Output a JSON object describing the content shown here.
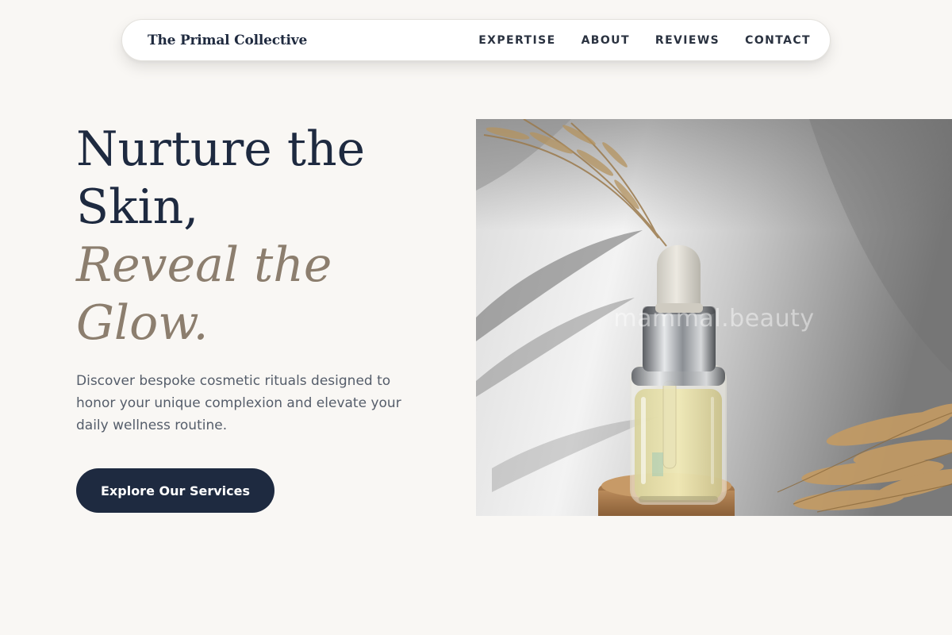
{
  "nav": {
    "brand": "The Primal Collective",
    "links": [
      {
        "label": "EXPERTISE"
      },
      {
        "label": "ABOUT"
      },
      {
        "label": "REVIEWS"
      },
      {
        "label": "CONTACT"
      }
    ]
  },
  "hero": {
    "headline_line1": "Nurture the Skin,",
    "headline_line2": "Reveal the Glow.",
    "description": "Discover bespoke cosmetic rituals designed to honor your unique complexion and elevate your daily wellness routine.",
    "cta_label": "Explore Our Services",
    "image_watermark": "mammal.beauty"
  },
  "colors": {
    "background": "#f9f7f4",
    "navy": "#1e2a40",
    "accent_taupe": "#8c7e6e",
    "body_text": "#555d6a"
  }
}
